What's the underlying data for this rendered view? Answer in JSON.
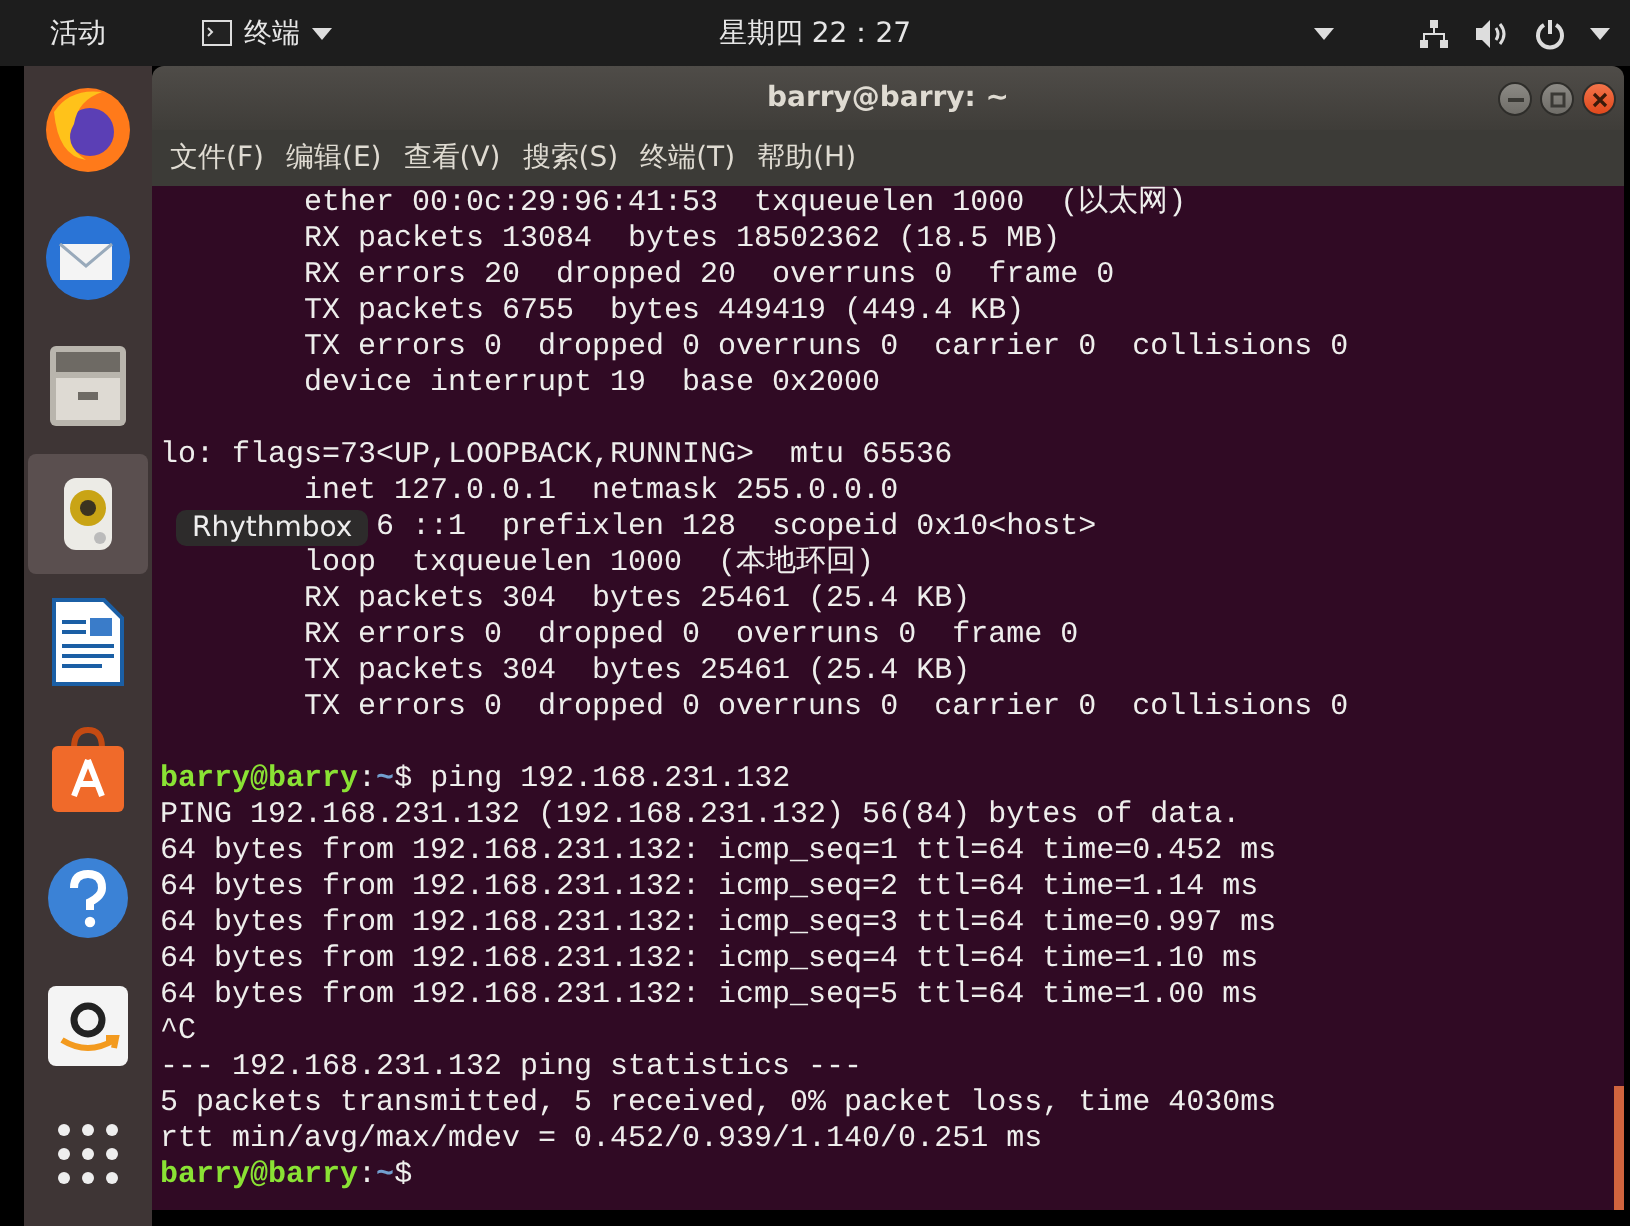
{
  "top_bar": {
    "activities": "活动",
    "app_menu": "终端",
    "clock": "星期四 22：27"
  },
  "dock": {
    "items": [
      {
        "kind": "browser",
        "highlighted": false
      },
      {
        "kind": "mail",
        "highlighted": false
      },
      {
        "kind": "files",
        "highlighted": false
      },
      {
        "kind": "music",
        "highlighted": true
      },
      {
        "kind": "writer",
        "highlighted": false
      },
      {
        "kind": "software",
        "highlighted": false
      },
      {
        "kind": "help",
        "highlighted": false
      },
      {
        "kind": "store",
        "highlighted": false
      },
      {
        "kind": "apps",
        "highlighted": false
      }
    ],
    "tooltip": "Rhythmbox"
  },
  "window": {
    "title": "barry@barry: ~",
    "menu": [
      "文件(F)",
      "编辑(E)",
      "查看(V)",
      "搜索(S)",
      "终端(T)",
      "帮助(H)"
    ],
    "terminal": [
      {
        "kind": "output",
        "text": "        ether 00:0c:29:96:41:53  txqueuelen 1000  (以太网)"
      },
      {
        "kind": "output",
        "text": "        RX packets 13084  bytes 18502362 (18.5 MB)"
      },
      {
        "kind": "output",
        "text": "        RX errors 20  dropped 20  overruns 0  frame 0"
      },
      {
        "kind": "output",
        "text": "        TX packets 6755  bytes 449419 (449.4 KB)"
      },
      {
        "kind": "output",
        "text": "        TX errors 0  dropped 0 overruns 0  carrier 0  collisions 0"
      },
      {
        "kind": "output",
        "text": "        device interrupt 19  base 0x2000"
      },
      {
        "kind": "blank"
      },
      {
        "kind": "output",
        "text": "lo: flags=73<UP,LOOPBACK,RUNNING>  mtu 65536"
      },
      {
        "kind": "output",
        "text": "        inet 127.0.0.1  netmask 255.0.0.0"
      },
      {
        "kind": "output",
        "text": "            6 ::1  prefixlen 128  scopeid 0x10<host>"
      },
      {
        "kind": "output",
        "text": "        loop  txqueuelen 1000  (本地环回)"
      },
      {
        "kind": "output",
        "text": "        RX packets 304  bytes 25461 (25.4 KB)"
      },
      {
        "kind": "output",
        "text": "        RX errors 0  dropped 0  overruns 0  frame 0"
      },
      {
        "kind": "output",
        "text": "        TX packets 304  bytes 25461 (25.4 KB)"
      },
      {
        "kind": "output",
        "text": "        TX errors 0  dropped 0 overruns 0  carrier 0  collisions 0"
      },
      {
        "kind": "blank"
      },
      {
        "kind": "prompt",
        "user": "barry@barry",
        "separator": ":",
        "path": "~",
        "symbol": "$",
        "command": "ping 192.168.231.132"
      },
      {
        "kind": "output",
        "text": "PING 192.168.231.132 (192.168.231.132) 56(84) bytes of data."
      },
      {
        "kind": "output",
        "text": "64 bytes from 192.168.231.132: icmp_seq=1 ttl=64 time=0.452 ms"
      },
      {
        "kind": "output",
        "text": "64 bytes from 192.168.231.132: icmp_seq=2 ttl=64 time=1.14 ms"
      },
      {
        "kind": "output",
        "text": "64 bytes from 192.168.231.132: icmp_seq=3 ttl=64 time=0.997 ms"
      },
      {
        "kind": "output",
        "text": "64 bytes from 192.168.231.132: icmp_seq=4 ttl=64 time=1.10 ms"
      },
      {
        "kind": "output",
        "text": "64 bytes from 192.168.231.132: icmp_seq=5 ttl=64 time=1.00 ms"
      },
      {
        "kind": "output",
        "text": "^C"
      },
      {
        "kind": "output",
        "text": "--- 192.168.231.132 ping statistics ---"
      },
      {
        "kind": "output",
        "text": "5 packets transmitted, 5 received, 0% packet loss, time 4030ms"
      },
      {
        "kind": "output",
        "text": "rtt min/avg/max/mdev = 0.452/0.939/1.140/0.251 ms"
      },
      {
        "kind": "prompt",
        "user": "barry@barry",
        "separator": ":",
        "path": "~",
        "symbol": "$"
      }
    ]
  }
}
